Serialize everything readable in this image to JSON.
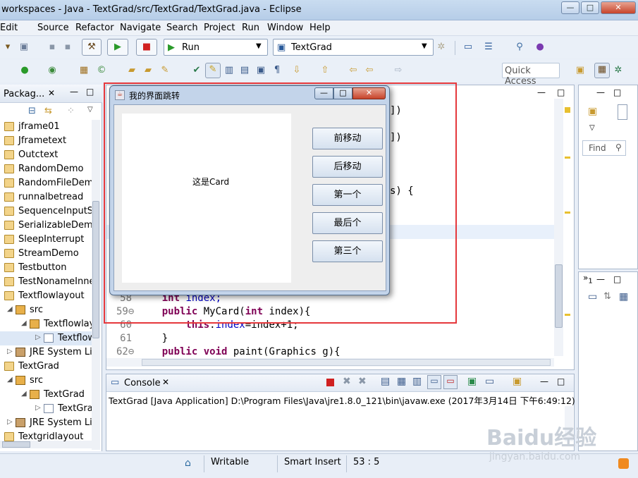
{
  "window": {
    "title": "workspaces - Java - TextGrad/src/TextGrad/TextGrad.java - Eclipse",
    "minimize": "—",
    "maximize": "□",
    "close": "✕"
  },
  "menu": [
    "Edit",
    "Source",
    "Refactor",
    "Navigate",
    "Search",
    "Project",
    "Run",
    "Window",
    "Help"
  ],
  "toolbar": {
    "run_combo": "Run",
    "config_combo": "TextGrad",
    "quick_access": "Quick Access"
  },
  "explorer": {
    "title": "Packag...",
    "items": [
      {
        "label": "jframe01",
        "type": "project",
        "indent": 0
      },
      {
        "label": "Jframetext",
        "type": "project",
        "indent": 0
      },
      {
        "label": "Outctext",
        "type": "project",
        "indent": 0
      },
      {
        "label": "RandomDemo",
        "type": "project",
        "indent": 0
      },
      {
        "label": "RandomFileDemo",
        "type": "project",
        "indent": 0
      },
      {
        "label": "runnalbetread",
        "type": "project",
        "indent": 0
      },
      {
        "label": "SequenceInputStr",
        "type": "project",
        "indent": 0
      },
      {
        "label": "SerializableDemo",
        "type": "project",
        "indent": 0
      },
      {
        "label": "SleepInterrupt",
        "type": "project",
        "indent": 0
      },
      {
        "label": "StreamDemo",
        "type": "project",
        "indent": 0
      },
      {
        "label": "Testbutton",
        "type": "project",
        "indent": 0
      },
      {
        "label": "TestNonameInner",
        "type": "project",
        "indent": 0
      },
      {
        "label": "Textflowlayout",
        "type": "project",
        "indent": 0
      },
      {
        "label": "src",
        "type": "folder",
        "indent": 1
      },
      {
        "label": "Textflowlay",
        "type": "package",
        "indent": 2
      },
      {
        "label": "Textflow",
        "type": "file",
        "indent": 3
      },
      {
        "label": "JRE System Lib",
        "type": "jre",
        "indent": 1
      },
      {
        "label": "TextGrad",
        "type": "project",
        "indent": 0
      },
      {
        "label": "src",
        "type": "folder",
        "indent": 1
      },
      {
        "label": "TextGrad",
        "type": "package",
        "indent": 2
      },
      {
        "label": "TextGra",
        "type": "file",
        "indent": 3
      },
      {
        "label": "JRE System Lib",
        "type": "jre",
        "indent": 1
      },
      {
        "label": "Textgridlayout",
        "type": "project",
        "indent": 0
      }
    ]
  },
  "editor": {
    "fragments": [
      "])",
      "])",
      "s) {"
    ],
    "lines": [
      {
        "num": "58",
        "code": "    int index;"
      },
      {
        "num": "59⊖",
        "code": "    public MyCard(int index){"
      },
      {
        "num": "60",
        "code": "        this.index=index+1;"
      },
      {
        "num": "61",
        "code": "    }"
      },
      {
        "num": "62⊖",
        "code": "    public void paint(Graphics g){"
      }
    ]
  },
  "console": {
    "tab_label": "Console",
    "output": "TextGrad [Java Application] D:\\Program Files\\Java\\jre1.8.0_121\\bin\\javaw.exe (2017年3月14日 下午6:49:12)"
  },
  "right_panel": {
    "find_label": "Find"
  },
  "status": {
    "writable": "Writable",
    "insert_mode": "Smart Insert",
    "position": "53 : 5"
  },
  "dialog": {
    "title": "我的界面跳转",
    "card_text": "这是Card",
    "buttons": [
      "前移动",
      "后移动",
      "第一个",
      "最后个",
      "第三个"
    ]
  },
  "watermark": {
    "brand": "Baidu经验",
    "url": "jingyan.baidu.com"
  },
  "colors": {
    "highlight_border": "#e5383c",
    "keyword": "#7f0055"
  }
}
